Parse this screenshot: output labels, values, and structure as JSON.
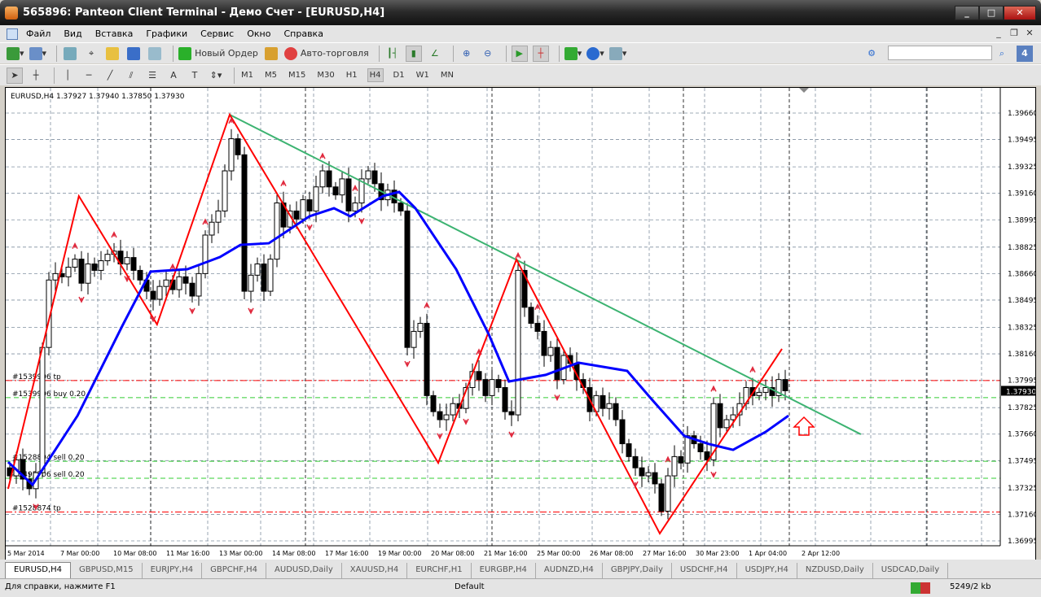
{
  "window": {
    "title": "565896: Panteon Client Terminal - Демо Счет - [EURUSD,H4]"
  },
  "menu": [
    "Файл",
    "Вид",
    "Вставка",
    "Графики",
    "Сервис",
    "Окно",
    "Справка"
  ],
  "toolbar": {
    "new_order": "Новый Ордер",
    "autotrading": "Авто-торговля",
    "notifications": "4"
  },
  "timeframes": [
    "M1",
    "M5",
    "M15",
    "M30",
    "H1",
    "H4",
    "D1",
    "W1",
    "MN"
  ],
  "selected_timeframe": "H4",
  "chart": {
    "header": "EURUSD,H4  1.37927 1.37940 1.37850 1.37930",
    "current_price": "1.37930",
    "price_ticks": [
      "1.39660",
      "1.39495",
      "1.39325",
      "1.39160",
      "1.38995",
      "1.38825",
      "1.38660",
      "1.38495",
      "1.38325",
      "1.38160",
      "1.37995",
      "1.37825",
      "1.37660",
      "1.37495",
      "1.37325",
      "1.37160",
      "1.36995"
    ],
    "time_ticks": [
      "5 Mar 2014",
      "7 Mar 00:00",
      "10 Mar 08:00",
      "11 Mar 16:00",
      "13 Mar 00:00",
      "14 Mar 08:00",
      "17 Mar 16:00",
      "19 Mar 00:00",
      "20 Mar 08:00",
      "21 Mar 16:00",
      "25 Mar 00:00",
      "26 Mar 08:00",
      "27 Mar 16:00",
      "30 Mar 23:00",
      "1 Apr 04:00",
      "2 Apr 12:00"
    ],
    "orders": [
      {
        "label": "#1539906 tp",
        "price": 1.37994,
        "color": "#ff0000"
      },
      {
        "label": "#1539906 buy 0.20",
        "price": 1.37887,
        "color": "#33cc33"
      },
      {
        "label": "#1528804 sell 0.20",
        "price": 1.37491,
        "color": "#33cc33"
      },
      {
        "label": "#1495706 sell 0.20",
        "price": 1.37385,
        "color": "#33cc33"
      },
      {
        "label": "#1528874 tp",
        "price": 1.37175,
        "color": "#ff0000"
      }
    ]
  },
  "chart_data": {
    "type": "candlestick",
    "symbol": "EURUSD",
    "timeframe": "H4",
    "first_open": 1.3745,
    "closes": [
      1.374,
      1.375,
      1.3738,
      1.3732,
      1.3742,
      1.382,
      1.3862,
      1.3866,
      1.3864,
      1.387,
      1.3875,
      1.386,
      1.3872,
      1.3868,
      1.3874,
      1.3878,
      1.388,
      1.3872,
      1.3876,
      1.3868,
      1.3862,
      1.3855,
      1.385,
      1.3858,
      1.3862,
      1.3856,
      1.3864,
      1.386,
      1.3852,
      1.3866,
      1.389,
      1.3898,
      1.3905,
      1.393,
      1.395,
      1.394,
      1.3855,
      1.3865,
      1.3872,
      1.3855,
      1.3875,
      1.391,
      1.3895,
      1.3905,
      1.39,
      1.3912,
      1.3905,
      1.392,
      1.393,
      1.392,
      1.3915,
      1.3925,
      1.3905,
      1.391,
      1.3925,
      1.393,
      1.3922,
      1.3912,
      1.3918,
      1.391,
      1.3905,
      1.382,
      1.383,
      1.3835,
      1.379,
      1.378,
      1.3775,
      1.3778,
      1.3785,
      1.3782,
      1.3795,
      1.3805,
      1.38,
      1.379,
      1.38,
      1.3795,
      1.378,
      1.3778,
      1.3868,
      1.3845,
      1.3835,
      1.383,
      1.3815,
      1.382,
      1.38,
      1.3815,
      1.381,
      1.38,
      1.3795,
      1.378,
      1.379,
      1.3782,
      1.3785,
      1.3775,
      1.376,
      1.3752,
      1.3745,
      1.374,
      1.3742,
      1.3735,
      1.3718,
      1.374,
      1.3752,
      1.3748,
      1.3765,
      1.376,
      1.3755,
      1.375,
      1.3785,
      1.377,
      1.3775,
      1.3778,
      1.3785,
      1.3795,
      1.379,
      1.3792,
      1.3795,
      1.379,
      1.38,
      1.3793
    ],
    "moving_average": [
      [
        -0.25,
        1.37486
      ],
      [
        3.5,
        1.37345
      ],
      [
        10.4,
        1.37775
      ],
      [
        17.25,
        1.38333
      ],
      [
        21.6,
        1.38672
      ],
      [
        27.25,
        1.38687
      ],
      [
        32.25,
        1.38763
      ],
      [
        35.4,
        1.38839
      ],
      [
        39.75,
        1.38849
      ],
      [
        46,
        1.39017
      ],
      [
        49.75,
        1.39067
      ],
      [
        52.25,
        1.39017
      ],
      [
        57.25,
        1.39143
      ],
      [
        59.75,
        1.39169
      ],
      [
        62.25,
        1.39067
      ],
      [
        68.5,
        1.38687
      ],
      [
        73.5,
        1.38282
      ],
      [
        76.6,
        1.37988
      ],
      [
        82.25,
        1.38029
      ],
      [
        87.25,
        1.38105
      ],
      [
        94.75,
        1.38054
      ],
      [
        98.5,
        1.37877
      ],
      [
        103.5,
        1.37649
      ],
      [
        107.25,
        1.37599
      ],
      [
        111,
        1.37562
      ],
      [
        116,
        1.37674
      ],
      [
        119.5,
        1.37775
      ]
    ],
    "zigzag": [
      [
        -0.25,
        1.37319
      ],
      [
        10.6,
        1.39143
      ],
      [
        22.6,
        1.38343
      ],
      [
        33.75,
        1.3965
      ],
      [
        65.75,
        1.37481
      ],
      [
        77.75,
        1.38748
      ],
      [
        99.75,
        1.37041
      ],
      [
        118.5,
        1.38191
      ]
    ],
    "trendline": [
      [
        33.75,
        1.3965
      ],
      [
        130.6,
        1.37659
      ]
    ],
    "fractals_up": [
      10,
      16,
      25,
      30,
      34,
      42,
      48,
      53,
      64,
      72,
      78,
      81,
      101,
      108,
      114
    ],
    "fractals_down": [
      4,
      11,
      18,
      22,
      28,
      37,
      46,
      54,
      61,
      66,
      70,
      77,
      84,
      96,
      108
    ],
    "ylim": [
      1.3693,
      1.3982
    ]
  },
  "colors": {
    "zigzag": "#ff0000",
    "ma": "#0000ff",
    "trend": "#3cb371",
    "bull": "#ffffff",
    "bear": "#000000"
  },
  "tabs": [
    "EURUSD,H4",
    "GBPUSD,M15",
    "EURJPY,H4",
    "GBPCHF,H4",
    "AUDUSD,Daily",
    "XAUUSD,H4",
    "EURCHF,H1",
    "EURGBP,H4",
    "AUDNZD,H4",
    "GBPJPY,Daily",
    "USDCHF,H4",
    "USDJPY,H4",
    "NZDUSD,Daily",
    "USDCAD,Daily"
  ],
  "status": {
    "help": "Для справки, нажмите F1",
    "profile": "Default",
    "traffic": "5249/2 kb"
  }
}
